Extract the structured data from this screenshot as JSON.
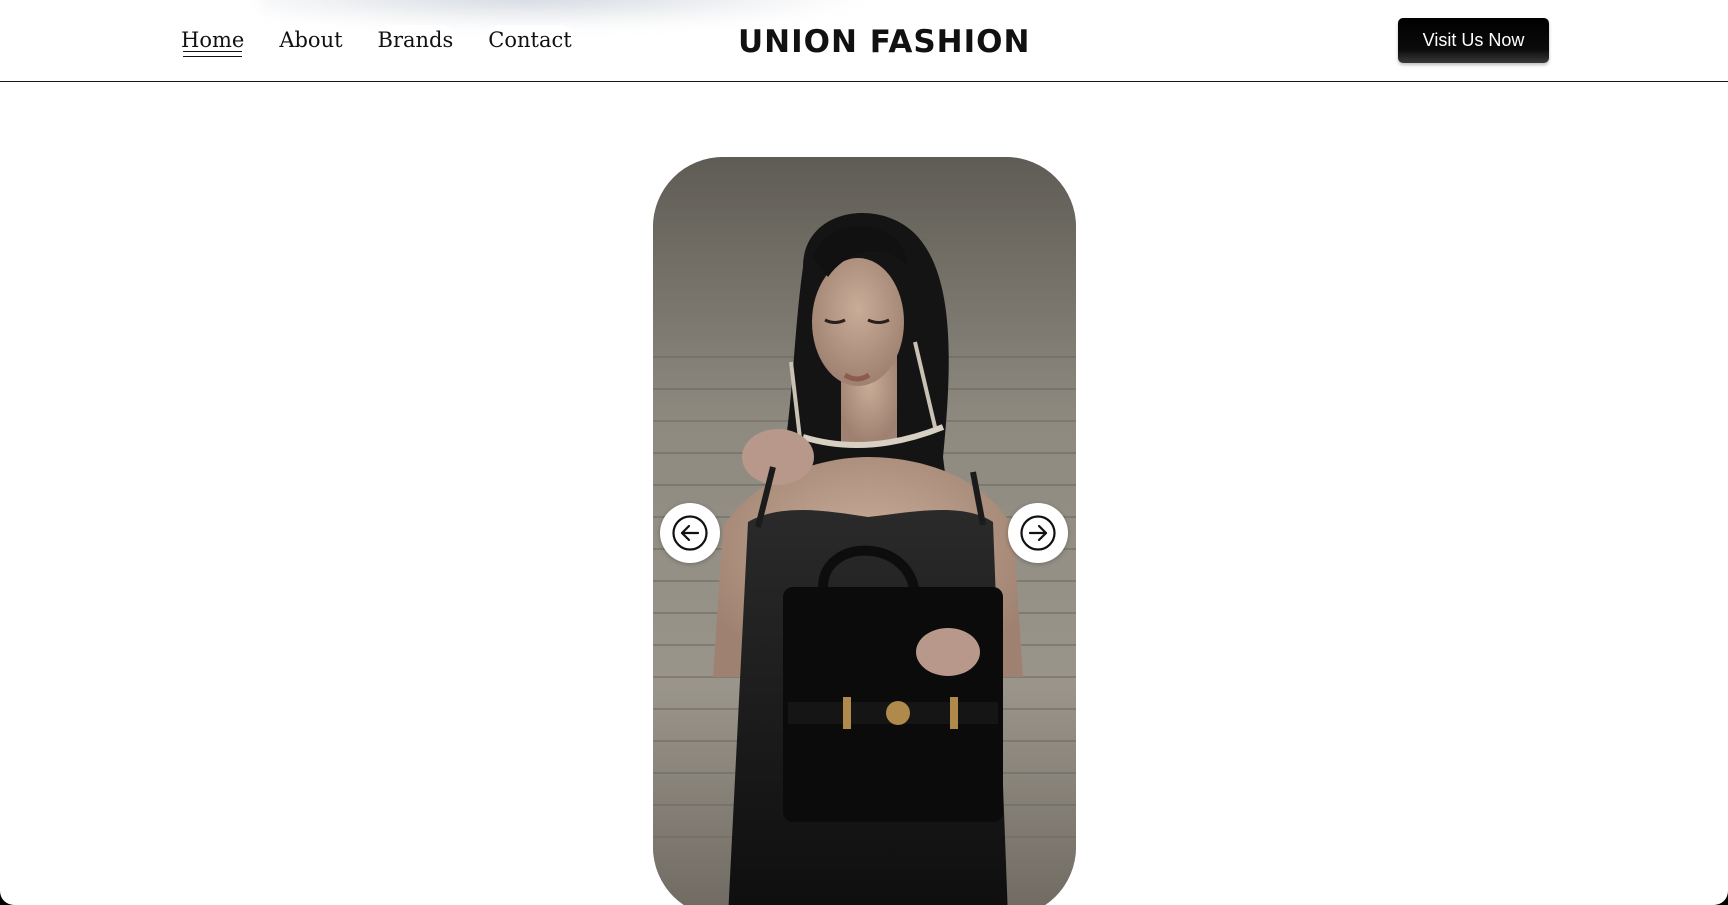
{
  "nav": {
    "items": [
      {
        "label": "Home",
        "active": true
      },
      {
        "label": "About",
        "active": false
      },
      {
        "label": "Brands",
        "active": false
      },
      {
        "label": "Contact",
        "active": false
      }
    ]
  },
  "brand": {
    "logo_text": "UNION FASHION"
  },
  "cta": {
    "label": "Visit Us Now"
  },
  "carousel": {
    "prev_icon": "arrow-left-circle-icon",
    "next_icon": "arrow-right-circle-icon"
  },
  "colors": {
    "page_bg": "#ffffff",
    "text": "#111111",
    "button_bg": "#000000",
    "button_text": "#ffffff"
  }
}
